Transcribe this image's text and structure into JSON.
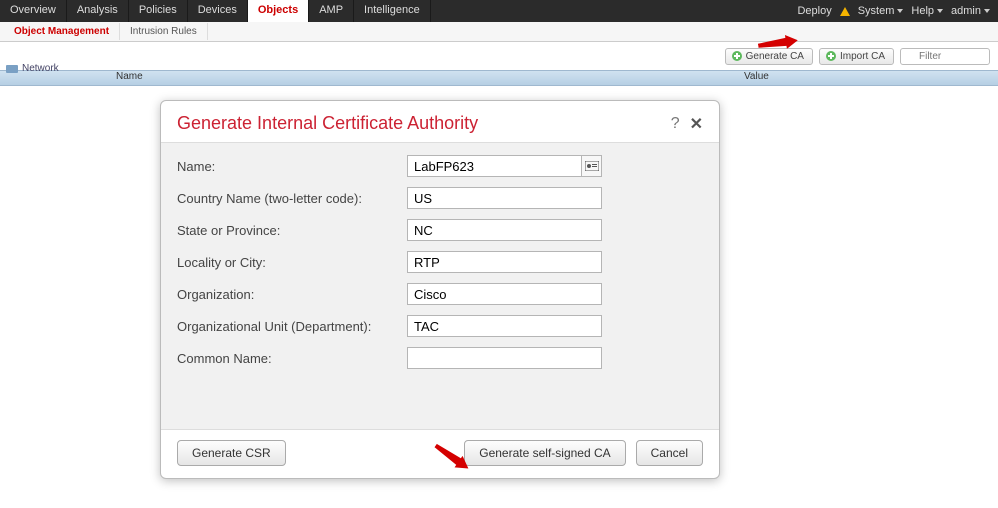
{
  "topnav": {
    "tabs": [
      "Overview",
      "Analysis",
      "Policies",
      "Devices",
      "Objects",
      "AMP",
      "Intelligence"
    ],
    "active": "Objects",
    "right": {
      "deploy": "Deploy",
      "system": "System",
      "help": "Help",
      "user": "admin"
    }
  },
  "subnav": {
    "tabs": [
      "Object Management",
      "Intrusion Rules"
    ],
    "active": "Object Management"
  },
  "toolbar": {
    "generate_ca": "Generate CA",
    "import_ca": "Import CA",
    "filter_placeholder": "Filter"
  },
  "columns": {
    "name": "Name",
    "value": "Value"
  },
  "side": {
    "network": "Network"
  },
  "modal": {
    "title": "Generate Internal Certificate Authority",
    "fields": {
      "name_label": "Name:",
      "name_value": "LabFP623",
      "country_label": "Country Name (two-letter code):",
      "country_value": "US",
      "state_label": "State or Province:",
      "state_value": "NC",
      "locality_label": "Locality or City:",
      "locality_value": "RTP",
      "org_label": "Organization:",
      "org_value": "Cisco",
      "ou_label": "Organizational Unit (Department):",
      "ou_value": "TAC",
      "cn_label": "Common Name:",
      "cn_value": ""
    },
    "buttons": {
      "generate_csr": "Generate CSR",
      "generate_self": "Generate self-signed CA",
      "cancel": "Cancel"
    }
  }
}
